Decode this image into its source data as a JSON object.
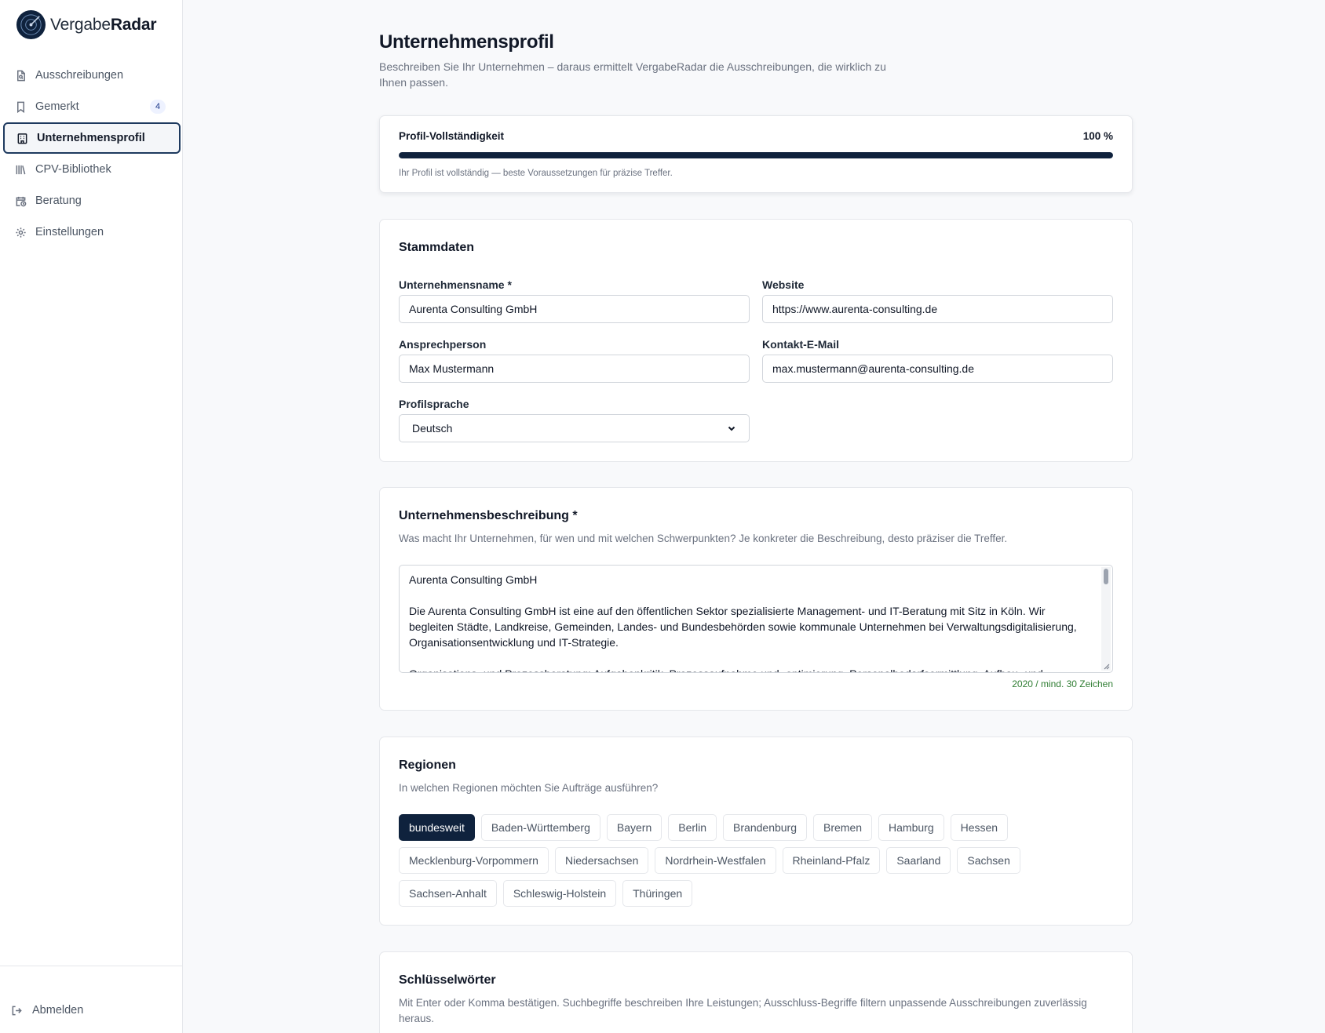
{
  "app": {
    "brand_light": "Vergabe",
    "brand_bold": "Radar",
    "accent_color": "#0f223d"
  },
  "sidebar": {
    "items": [
      {
        "label": "Ausschreibungen",
        "icon": "file-search-icon"
      },
      {
        "label": "Gemerkt",
        "icon": "bookmark-icon",
        "badge": "4"
      },
      {
        "label": "Unternehmensprofil",
        "icon": "building-icon",
        "active": true
      },
      {
        "label": "CPV-Bibliothek",
        "icon": "library-icon"
      },
      {
        "label": "Beratung",
        "icon": "calendar-clock-icon"
      },
      {
        "label": "Einstellungen",
        "icon": "gear-icon"
      }
    ],
    "logout_label": "Abmelden"
  },
  "header": {
    "title": "Unternehmensprofil",
    "subtitle": "Beschreiben Sie Ihr Unternehmen – daraus ermittelt VergabeRadar die Ausschreibungen, die wirklich zu Ihnen passen."
  },
  "progress": {
    "title": "Profil-Vollständigkeit",
    "value_label": "100 %",
    "percent": 100,
    "note": "Ihr Profil ist vollständig — beste Voraussetzungen für präzise Treffer."
  },
  "stammdaten": {
    "title": "Stammdaten",
    "company_label": "Unternehmensname *",
    "company_value": "Aurenta Consulting GmbH",
    "website_label": "Website",
    "website_value": "https://www.aurenta-consulting.de",
    "contact_label": "Ansprechperson",
    "contact_value": "Max Mustermann",
    "email_label": "Kontakt-E-Mail",
    "email_value": "max.mustermann@aurenta-consulting.de",
    "language_label": "Profilsprache",
    "language_value": "Deutsch"
  },
  "description": {
    "title": "Unternehmensbeschreibung *",
    "subtitle": "Was macht Ihr Unternehmen, für wen und mit welchen Schwerpunkten? Je konkreter die Beschreibung, desto präziser die Treffer.",
    "text": "Aurenta Consulting GmbH\n\nDie Aurenta Consulting GmbH ist eine auf den öffentlichen Sektor spezialisierte Management- und IT-Beratung mit Sitz in Köln. Wir begleiten Städte, Landkreise, Gemeinden, Landes- und Bundesbehörden sowie kommunale Unternehmen bei Verwaltungsdigitalisierung, Organisationsentwicklung und IT-Strategie.\n\nOrganisations- und Prozessberatung: Aufgabenkritik, Prozessaufnahme und -optimierung, Personalbedarfsermittlung, Aufbau- und",
    "char_count": "2020 / mind. 30 Zeichen"
  },
  "regions": {
    "title": "Regionen",
    "subtitle": "In welchen Regionen möchten Sie Aufträge ausführen?",
    "rows": [
      [
        "bundesweit",
        "Baden-Württemberg",
        "Bayern",
        "Berlin",
        "Brandenburg",
        "Bremen",
        "Hamburg",
        "Hessen"
      ],
      [
        "Mecklenburg-Vorpommern",
        "Niedersachsen",
        "Nordrhein-Westfalen",
        "Rheinland-Pfalz",
        "Saarland",
        "Sachsen"
      ],
      [
        "Sachsen-Anhalt",
        "Schleswig-Holstein",
        "Thüringen"
      ]
    ],
    "selected": [
      "bundesweit"
    ]
  },
  "keywords": {
    "title": "Schlüsselwörter",
    "subtitle": "Mit Enter oder Komma bestätigen. Suchbegriffe beschreiben Ihre Leistungen; Ausschluss-Begriffe filtern unpassende Ausschreibungen zuverlässig heraus."
  }
}
